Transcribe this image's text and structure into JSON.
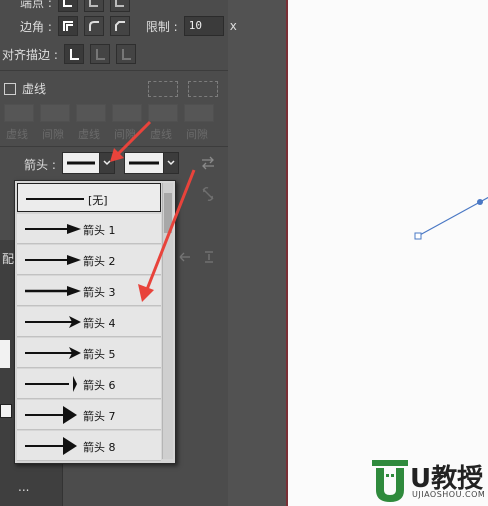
{
  "panel": {
    "top_row_label": "端点 :",
    "corner_label": "边角 :",
    "limit_label": "限制 :",
    "limit_value": "10",
    "limit_unit": "x",
    "align_label": "对齐描边 :",
    "dashed_label": "虚线",
    "dash_labels": [
      "虚线",
      "间隙",
      "虚线",
      "间隙",
      "虚线",
      "间隙"
    ],
    "arrow_label": "箭头 :",
    "side_label_1": "配",
    "left_dots": "...",
    "chevron": "⌄"
  },
  "dropdown": {
    "items": [
      {
        "name": "[无]",
        "type": "none"
      },
      {
        "name": "箭头 1",
        "type": "arrow",
        "head": 1
      },
      {
        "name": "箭头 2",
        "type": "arrow",
        "head": 2
      },
      {
        "name": "箭头 3",
        "type": "arrow",
        "head": 3
      },
      {
        "name": "箭头 4",
        "type": "arrow",
        "head": 4
      },
      {
        "name": "箭头 5",
        "type": "arrow",
        "head": 5
      },
      {
        "name": "箭头 6",
        "type": "arrow",
        "head": 6
      },
      {
        "name": "箭头 7",
        "type": "arrow",
        "head": 7
      },
      {
        "name": "箭头 8",
        "type": "arrow",
        "head": 8
      }
    ],
    "selected_index": 0
  },
  "watermark": {
    "brand": "U教授",
    "site": "UJIAOSHOU.COM"
  },
  "colors": {
    "accent_red": "#e8433b",
    "line_blue": "#4a78c4",
    "logo_green": "#2f8a3c"
  }
}
